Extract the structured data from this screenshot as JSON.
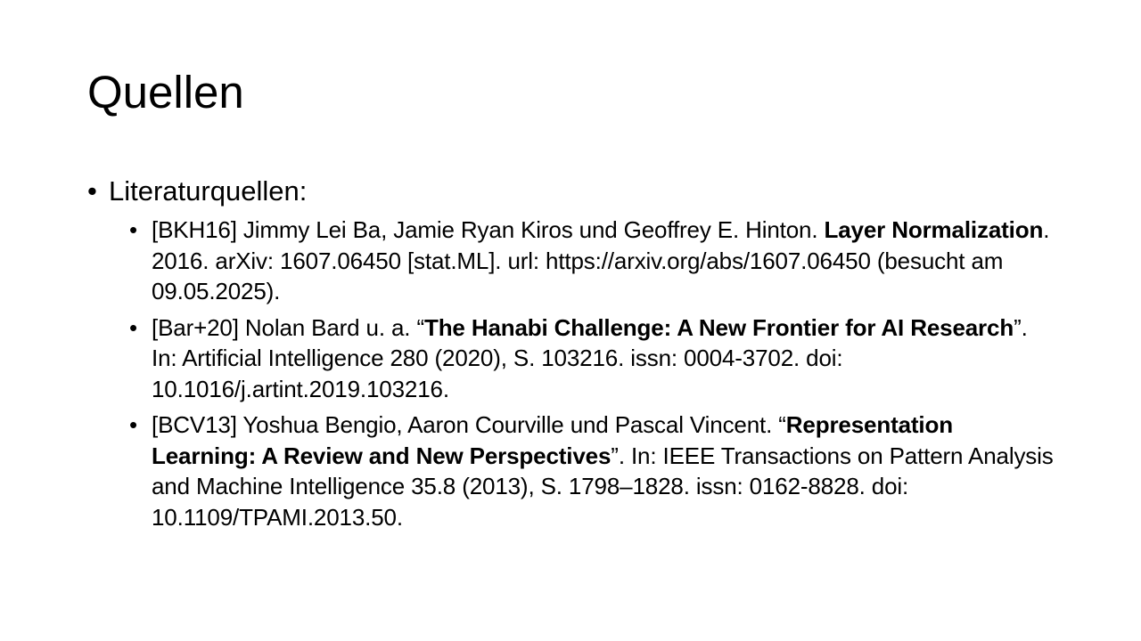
{
  "slide": {
    "title": "Quellen",
    "bullet_glyph": "•",
    "section": {
      "label": "Literaturquellen:"
    },
    "references": [
      {
        "prefix": "[BKH16] Jimmy Lei Ba, Jamie Ryan Kiros und Geoffrey E. Hinton. ",
        "open_quote": "",
        "title": "Layer Normalization",
        "close_quote": "",
        "rest": ". 2016. arXiv: 1607.06450 [stat.ML]. url: https://arxiv.org/abs/1607.06450 (besucht am 09.05.2025)."
      },
      {
        "prefix": "[Bar+20] Nolan Bard u. a. ",
        "open_quote": "“",
        "title": "The Hanabi Challenge: A New Frontier for AI Research",
        "close_quote": "”",
        "rest": ". In: Artificial Intelligence 280 (2020), S. 103216. issn: 0004-3702. doi: 10.1016/j.artint.2019.103216."
      },
      {
        "prefix": "[BCV13] Yoshua Bengio, Aaron Courville und Pascal Vincent. ",
        "open_quote": "“",
        "title": "Representation Learning: A Review and New Perspectives",
        "close_quote": "”",
        "rest": ". In: IEEE Transactions on Pattern Analysis and Machine Intelligence 35.8 (2013), S. 1798–1828. issn: 0162-8828. doi: 10.1109/TPAMI.2013.50."
      }
    ]
  }
}
